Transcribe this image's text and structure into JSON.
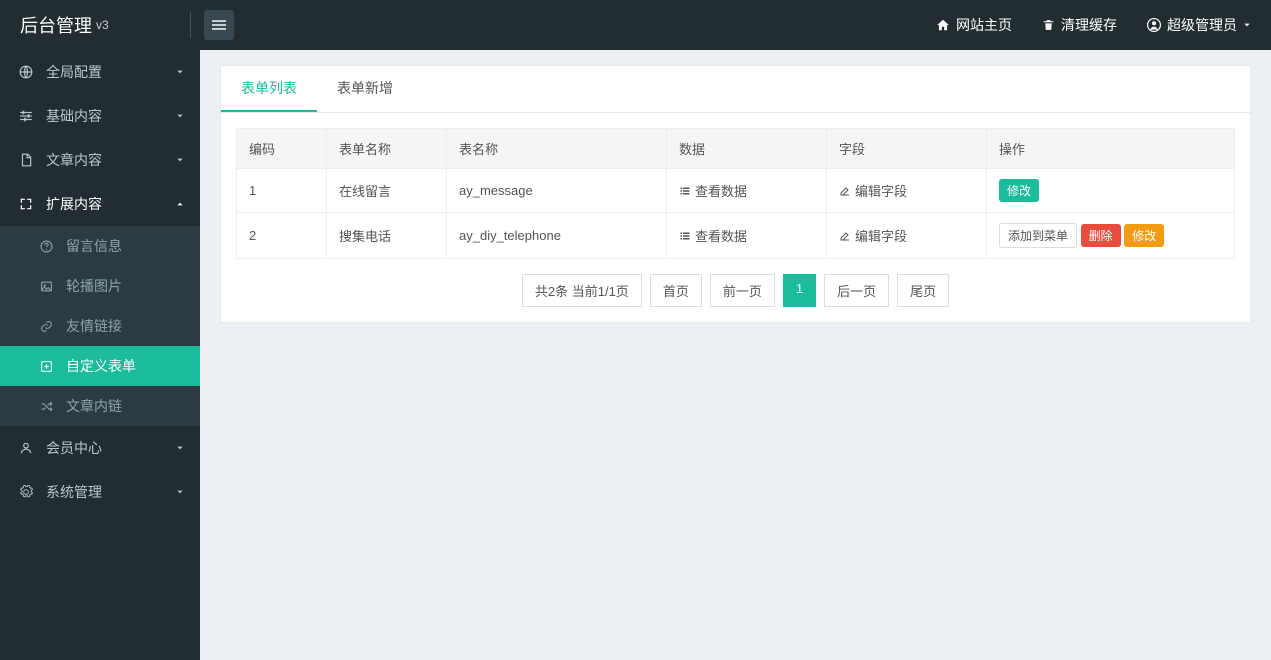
{
  "brand": {
    "name": "后台管理",
    "version": "v3"
  },
  "topnav": {
    "home": "网站主页",
    "clear_cache": "清理缓存",
    "user": "超级管理员"
  },
  "sidebar": {
    "global": "全局配置",
    "basic": "基础内容",
    "article": "文章内容",
    "extend": "扩展内容",
    "extend_children": {
      "message": "留言信息",
      "slide": "轮播图片",
      "link": "友情链接",
      "form": "自定义表单",
      "tags": "文章内链"
    },
    "member": "会员中心",
    "system": "系统管理"
  },
  "tabs": {
    "list": "表单列表",
    "add": "表单新增"
  },
  "table": {
    "headers": {
      "code": "编码",
      "name": "表单名称",
      "table": "表名称",
      "data": "数据",
      "field": "字段",
      "action": "操作"
    },
    "labels": {
      "view_data": "查看数据",
      "edit_field": "编辑字段",
      "modify": "修改",
      "add_menu": "添加到菜单",
      "delete": "删除"
    },
    "rows": [
      {
        "code": "1",
        "name": "在线留言",
        "table": "ay_message",
        "system": true
      },
      {
        "code": "2",
        "name": "搜集电话",
        "table": "ay_diy_telephone",
        "system": false
      }
    ]
  },
  "pagination": {
    "info": "共2条 当前1/1页",
    "first": "首页",
    "prev": "前一页",
    "current": "1",
    "next": "后一页",
    "last": "尾页"
  }
}
